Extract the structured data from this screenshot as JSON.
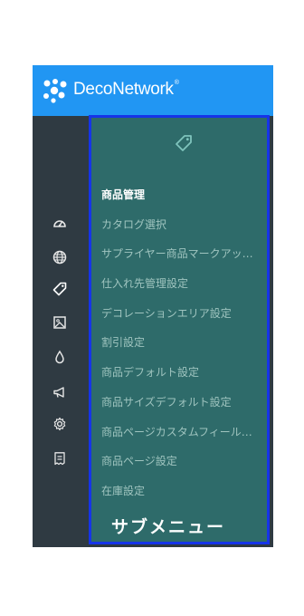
{
  "header": {
    "brand": "DecoNetwork",
    "trademark": "®",
    "background_color": "#2196f3"
  },
  "rail": {
    "icons": [
      "dashboard-gauge-icon",
      "globe-icon",
      "tag-icon",
      "image-icon",
      "drop-icon",
      "megaphone-icon",
      "gear-icon",
      "receipt-icon"
    ],
    "active_icon": "tag-icon"
  },
  "submenu": {
    "header_icon": "tag-icon",
    "items": [
      {
        "label": "商品管理",
        "active": true
      },
      {
        "label": "カタログ選択",
        "active": false
      },
      {
        "label": "サプライヤー商品マークアッ…",
        "active": false
      },
      {
        "label": "仕入れ先管理設定",
        "active": false
      },
      {
        "label": "デコレーションエリア設定",
        "active": false
      },
      {
        "label": "割引設定",
        "active": false
      },
      {
        "label": "商品デフォルト設定",
        "active": false
      },
      {
        "label": "商品サイズデフォルト設定",
        "active": false
      },
      {
        "label": "商品ページカスタムフィール…",
        "active": false
      },
      {
        "label": "商品ページ設定",
        "active": false
      },
      {
        "label": "在庫設定",
        "active": false
      }
    ],
    "annotation": "サブメニュー",
    "highlight_color": "#1634e8",
    "background_color": "#2e6b6a"
  }
}
